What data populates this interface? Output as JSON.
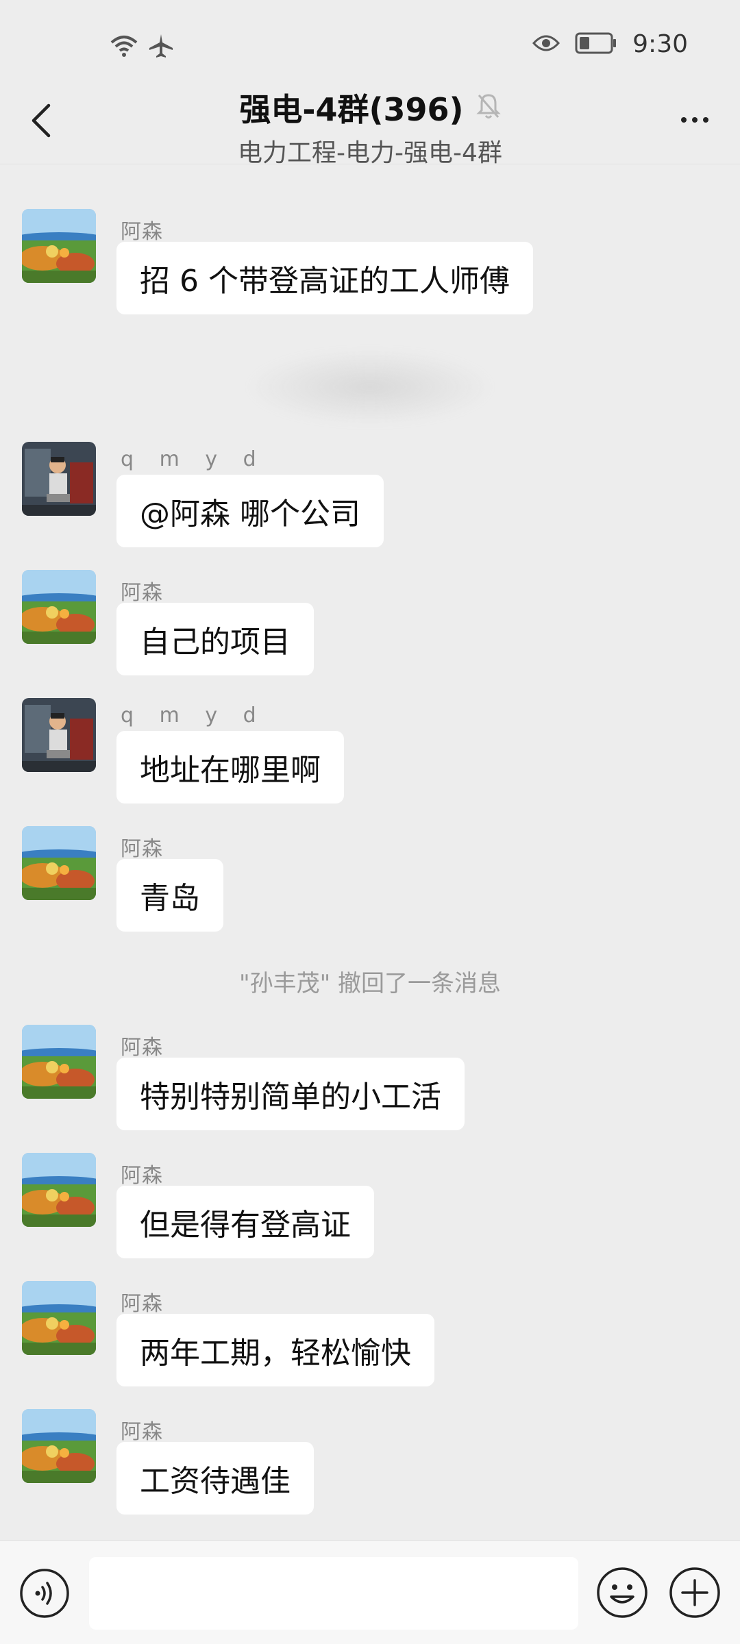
{
  "status_bar": {
    "time": "9:30",
    "icons": [
      "wifi-icon",
      "airplane-icon",
      "eye-icon",
      "battery-icon"
    ]
  },
  "header": {
    "title": "强电-4群(396)",
    "subtitle": "电力工程-电力-强电-4群",
    "icons": [
      "back-arrow-icon",
      "mute-bell-icon",
      "more-icon"
    ]
  },
  "messages": [
    {
      "sender": "阿森",
      "text": "招 6 个带登高证的工人师傅",
      "avatar": "landscape"
    },
    {
      "sender": "q m y d",
      "text": "@阿森  哪个公司",
      "avatar": "worker"
    },
    {
      "sender": "阿森",
      "text": "自己的项目",
      "avatar": "landscape"
    },
    {
      "sender": "q m y d",
      "text": "地址在哪里啊",
      "avatar": "worker"
    },
    {
      "sender": "阿森",
      "text": "青岛",
      "avatar": "landscape"
    },
    {
      "sender": "阿森",
      "text": "特别特别简单的小工活",
      "avatar": "landscape"
    },
    {
      "sender": "阿森",
      "text": "但是得有登高证",
      "avatar": "landscape"
    },
    {
      "sender": "阿森",
      "text": "两年工期，轻松愉快",
      "avatar": "landscape"
    },
    {
      "sender": "阿森",
      "text": "工资待遇佳",
      "avatar": "landscape"
    }
  ],
  "system_notice": "\"孙丰茂\" 撤回了一条消息",
  "input": {
    "value": "",
    "icons": [
      "voice-icon",
      "emoji-icon",
      "plus-icon"
    ]
  },
  "colors": {
    "background": "#ededed",
    "bubble": "#ffffff",
    "sender_text": "#888888",
    "notice_text": "#9a9a9a"
  }
}
